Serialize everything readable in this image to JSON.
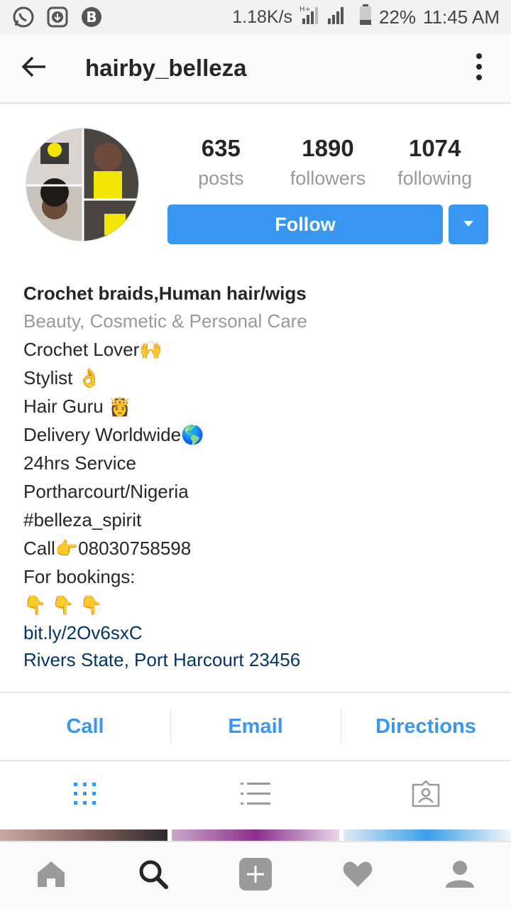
{
  "status_bar": {
    "net_speed": "1.18K/s",
    "battery": "22%",
    "time": "11:45 AM"
  },
  "header": {
    "username": "hairby_belleza"
  },
  "stats": [
    {
      "value": "635",
      "label": "posts"
    },
    {
      "value": "1890",
      "label": "followers"
    },
    {
      "value": "1074",
      "label": "following"
    }
  ],
  "follow_button": "Follow",
  "bio": {
    "name": "Crochet braids,Human hair/wigs",
    "category": "Beauty, Cosmetic & Personal Care",
    "lines": [
      "Crochet Lover🙌",
      "Stylist 👌",
      "Hair Guru 👸",
      "Delivery Worldwide🌎",
      "24hrs Service",
      "Portharcourt/Nigeria",
      "#belleza_spirit",
      "Call👉08030758598",
      "For bookings:",
      "👇 👇 👇"
    ],
    "link": "bit.ly/2Ov6sxC",
    "address": "Rivers State, Port Harcourt 23456"
  },
  "actions": [
    "Call",
    "Email",
    "Directions"
  ],
  "colors": {
    "accent": "#3897f0",
    "link": "#003569",
    "muted": "#999999"
  }
}
